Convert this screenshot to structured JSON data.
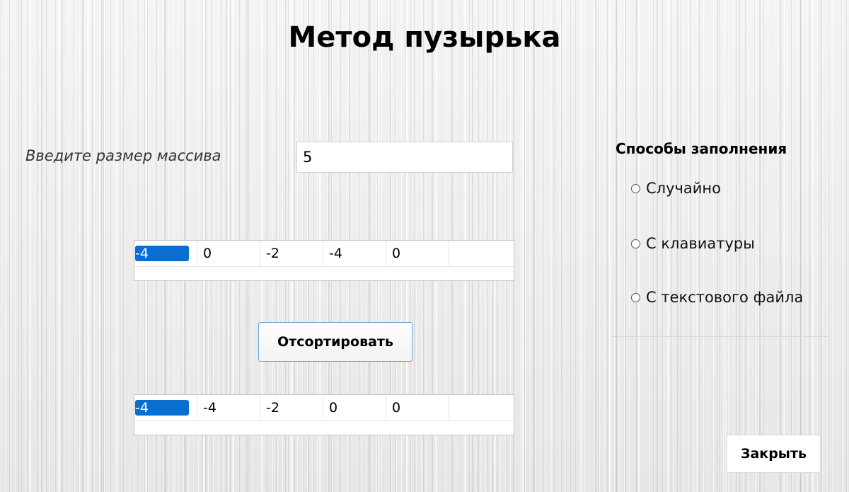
{
  "title": "Метод пузырька",
  "size_label": "Введите размер массива",
  "size_input_value": "5",
  "input_array": [
    "-4",
    "0",
    "-2",
    "-4",
    "0"
  ],
  "sort_button": "Отсортировать",
  "sorted_array": [
    "-4",
    "-4",
    "-2",
    "0",
    "0"
  ],
  "fill_methods": {
    "title": "Способы заполнения",
    "options": [
      "Случайно",
      "С клавиатуры",
      "С текстового файла"
    ]
  },
  "close_button": "Закрыть",
  "colors": {
    "selection": "#0a6ed1",
    "button_border": "#6ba6dc"
  }
}
